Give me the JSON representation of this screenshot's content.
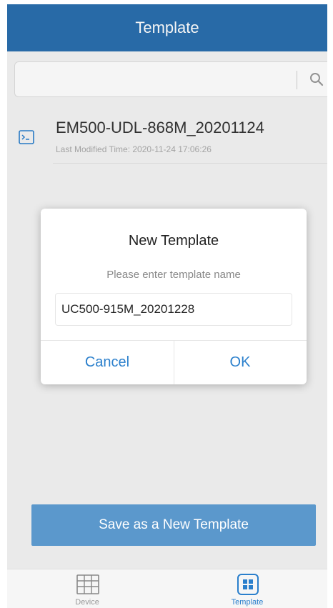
{
  "header": {
    "title": "Template"
  },
  "search": {
    "value": "",
    "placeholder": "",
    "icon": "search-icon"
  },
  "templates": [
    {
      "name": "EM500-UDL-868M_20201124",
      "meta": "Last Modified Time: 2020-11-24 17:06:26",
      "icon": "terminal-icon"
    }
  ],
  "save_button": {
    "label": "Save as a  New Template"
  },
  "tabs": [
    {
      "label": "Device",
      "icon": "device-grid-icon",
      "active": false
    },
    {
      "label": "Template",
      "icon": "template-grid-icon",
      "active": true
    }
  ],
  "dialog": {
    "title": "New Template",
    "prompt": "Please enter template name",
    "input_value": "UC500-915M_20201228",
    "cancel_label": "Cancel",
    "ok_label": "OK"
  },
  "colors": {
    "header": "#2a6fae",
    "accent": "#2a7fcc",
    "save_button": "#5b98cc"
  }
}
